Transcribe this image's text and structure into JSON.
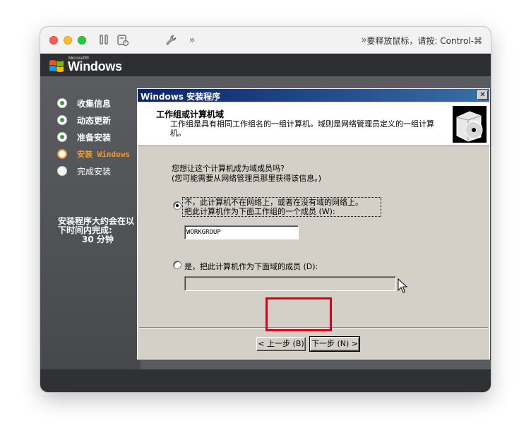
{
  "toolbar": {
    "hint": "要释放鼠标，请按: Control-⌘",
    "more_symbol": "»"
  },
  "brand": {
    "microsoft": "Microsoft®",
    "windows": "Windows"
  },
  "steps": [
    {
      "label": "收集信息",
      "state": "done"
    },
    {
      "label": "动态更新",
      "state": "done"
    },
    {
      "label": "准备安装",
      "state": "done"
    },
    {
      "label": "安装 Windows",
      "state": "current"
    },
    {
      "label": "完成安装",
      "state": "todo"
    }
  ],
  "time_note": {
    "line1": "安装程序大约会在以",
    "line2": "下时间内完成:",
    "minutes": "30 分钟"
  },
  "dialog": {
    "title": "Windows 安装程序",
    "close_symbol": "✕",
    "header_title": "工作组或计算机域",
    "header_desc": "工作组是具有相同工作组名的一组计算机。域则是网络管理员定义的一组计算机。",
    "question_line1": "您想让这个计算机成为域成员吗?",
    "question_line2": "(您可能需要从网络管理员那里获得该信息。)",
    "option_no_line1": "不，此计算机不在网络上，或者在没有域的网络上。",
    "option_no_line2": "把此计算机作为下面工作组的一个成员 (W):",
    "option_no_selected": true,
    "workgroup_value": "WORKGROUP",
    "option_yes": "是，把此计算机作为下面域的成员 (D):",
    "domain_value": "",
    "back_label": "< 上一步 (B)",
    "next_label": "下一步 (N) >"
  },
  "colors": {
    "title_bar": "#0a246a",
    "current_step": "#f39a2f",
    "highlight_box": "#d9001b"
  }
}
